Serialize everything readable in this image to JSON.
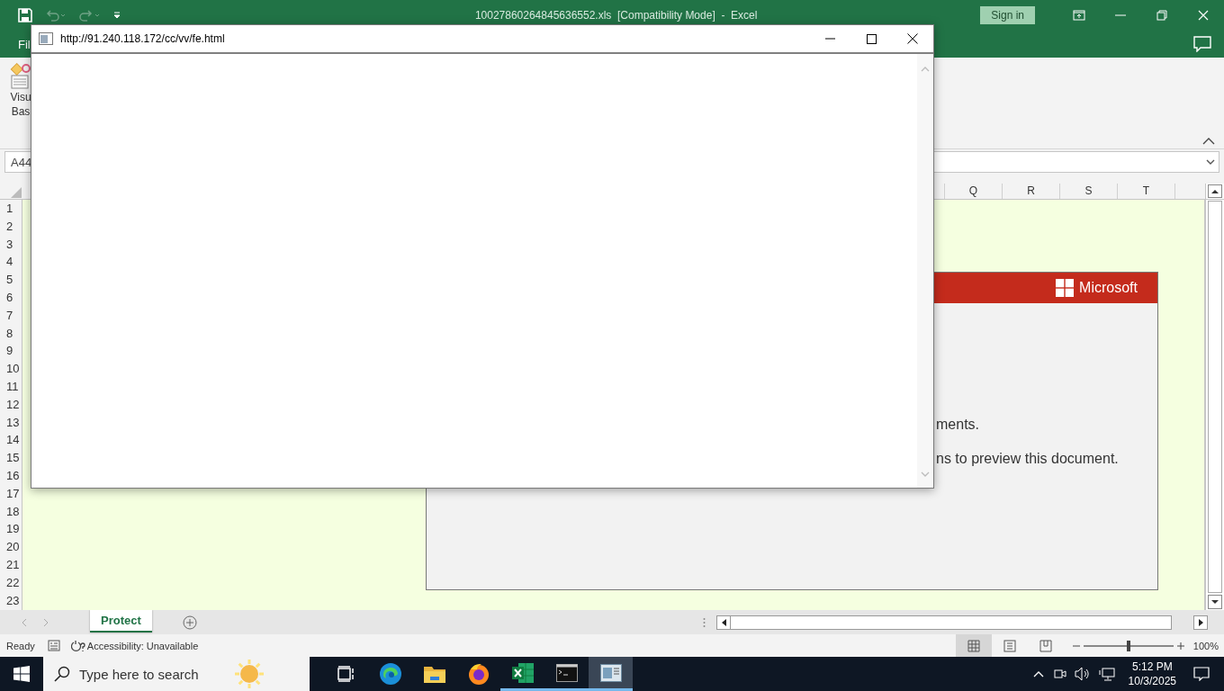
{
  "excel": {
    "title_bar": {
      "title": "10027860264845636552.xls  [Compatibility Mode]  -  Excel",
      "sign_in": "Sign in"
    },
    "menu": {
      "file_tab": "Fil"
    },
    "ribbon": {
      "button_lines": [
        "Visu",
        "Bas"
      ]
    },
    "name_box": "A44",
    "columns": [
      "Q",
      "R",
      "S",
      "T"
    ],
    "rows": [
      "1",
      "2",
      "3",
      "4",
      "5",
      "6",
      "7",
      "8",
      "9",
      "10",
      "11",
      "12",
      "13",
      "14",
      "15",
      "16",
      "17",
      "18",
      "19",
      "20",
      "21",
      "22",
      "23"
    ],
    "notice": {
      "brand": "Microsoft",
      "lines": [
        "ments.",
        "ns to preview this document."
      ]
    },
    "sheet_tabs": [
      {
        "label": "Protect",
        "selected": true
      }
    ],
    "status": {
      "mode": "Ready",
      "accessibility": "Accessibility: Unavailable",
      "views": [
        {
          "kind": "normal",
          "selected": true
        },
        {
          "kind": "page_layout",
          "selected": false
        },
        {
          "kind": "page_break",
          "selected": false
        }
      ],
      "zoom": {
        "level": 0.5,
        "reading": "100%"
      }
    }
  },
  "popup": {
    "url": "http://91.240.118.172/cc/vv/fe.html"
  },
  "taskbar": {
    "search": {
      "placeholder": "Type here to search"
    },
    "apps": [
      {
        "kind": "task_view",
        "running": false,
        "selected": false
      },
      {
        "kind": "edge",
        "running": false,
        "selected": false
      },
      {
        "kind": "explorer",
        "running": false,
        "selected": false
      },
      {
        "kind": "firefox",
        "running": false,
        "selected": false
      },
      {
        "kind": "excel",
        "running": true,
        "selected": false
      },
      {
        "kind": "terminal",
        "running": true,
        "selected": false
      },
      {
        "kind": "window",
        "running": true,
        "selected": true
      }
    ],
    "time": "5:12 PM",
    "date": "10/3/2025"
  }
}
